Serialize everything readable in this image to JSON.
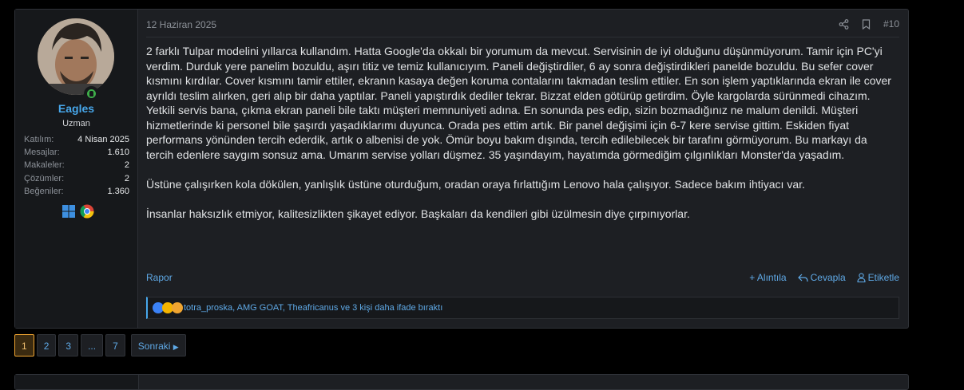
{
  "post": {
    "date": "12 Haziran 2025",
    "number": "#10",
    "paragraphs": [
      "2 farklı Tulpar modelini yıllarca kullandım. Hatta Google'da okkalı bir yorumum da mevcut. Servisinin de iyi olduğunu düşünmüyorum. Tamir için PC'yi verdim. Durduk yere panelim bozuldu, aşırı titiz ve temiz kullanıcıyım. Paneli değiştirdiler, 6 ay sonra değiştirdikleri panelde bozuldu. Bu sefer cover kısmını kırdılar. Cover kısmını tamir ettiler, ekranın kasaya değen koruma contalarını takmadan teslim ettiler. En son işlem yaptıklarında ekran ile cover ayrıldı teslim alırken, geri alıp bir daha yaptılar. Paneli yapıştırdık dediler tekrar. Bizzat elden götürüp getirdim. Öyle kargolarda sürünmedi cihazım. Yetkili servis bana, çıkma ekran paneli bile taktı müşteri memnuniyeti adına. En sonunda pes edip, sizin bozmadığınız ne malum denildi. Müşteri hizmetlerinde ki personel bile şaşırdı yaşadıklarımı duyunca. Orada pes ettim artık. Bir panel değişimi için 6-7 kere servise gittim. Eskiden fiyat performans yönünden tercih ederdik, artık o albenisi de yok. Ömür boyu bakım dışında, tercih edilebilecek bir tarafını görmüyorum. Bu markayı da tercih edenlere saygım sonsuz ama. Umarım servise yolları düşmez. 35 yaşındayım, hayatımda görmediğim çılgınlıkları Monster'da yaşadım.",
      "Üstüne çalışırken kola dökülen, yanlışlık üstüne oturduğum, oradan oraya fırlattığım Lenovo hala çalışıyor. Sadece bakım ihtiyacı var.",
      "İnsanlar haksızlık etmiyor, kalitesizlikten şikayet ediyor. Başkaları da kendileri gibi üzülmesin diye çırpınıyorlar."
    ],
    "report_label": "Rapor",
    "actions": {
      "quote": "+ Alıntıla",
      "reply": "Cevapla",
      "tag": "Etiketle"
    },
    "reactions_text": "totra_proska, AMG GOAT, Theafricanus ve 3 kişi daha ifade bıraktı"
  },
  "user": {
    "name": "Eagles",
    "title": "Uzman",
    "stats": [
      {
        "label": "Katılım:",
        "value": "4 Nisan 2025"
      },
      {
        "label": "Mesajlar:",
        "value": "1.610"
      },
      {
        "label": "Makaleler:",
        "value": "2"
      },
      {
        "label": "Çözümler:",
        "value": "2"
      },
      {
        "label": "Beğeniler:",
        "value": "1.360"
      }
    ],
    "badges": [
      "windows-icon",
      "chrome-icon"
    ]
  },
  "pagination": {
    "pages": [
      "1",
      "2",
      "3",
      "...",
      "7"
    ],
    "current": "1",
    "next_label": "Sonraki"
  },
  "colors": {
    "link": "#47a7eb",
    "accent": "#f0a531",
    "online": "#3eae4a"
  }
}
